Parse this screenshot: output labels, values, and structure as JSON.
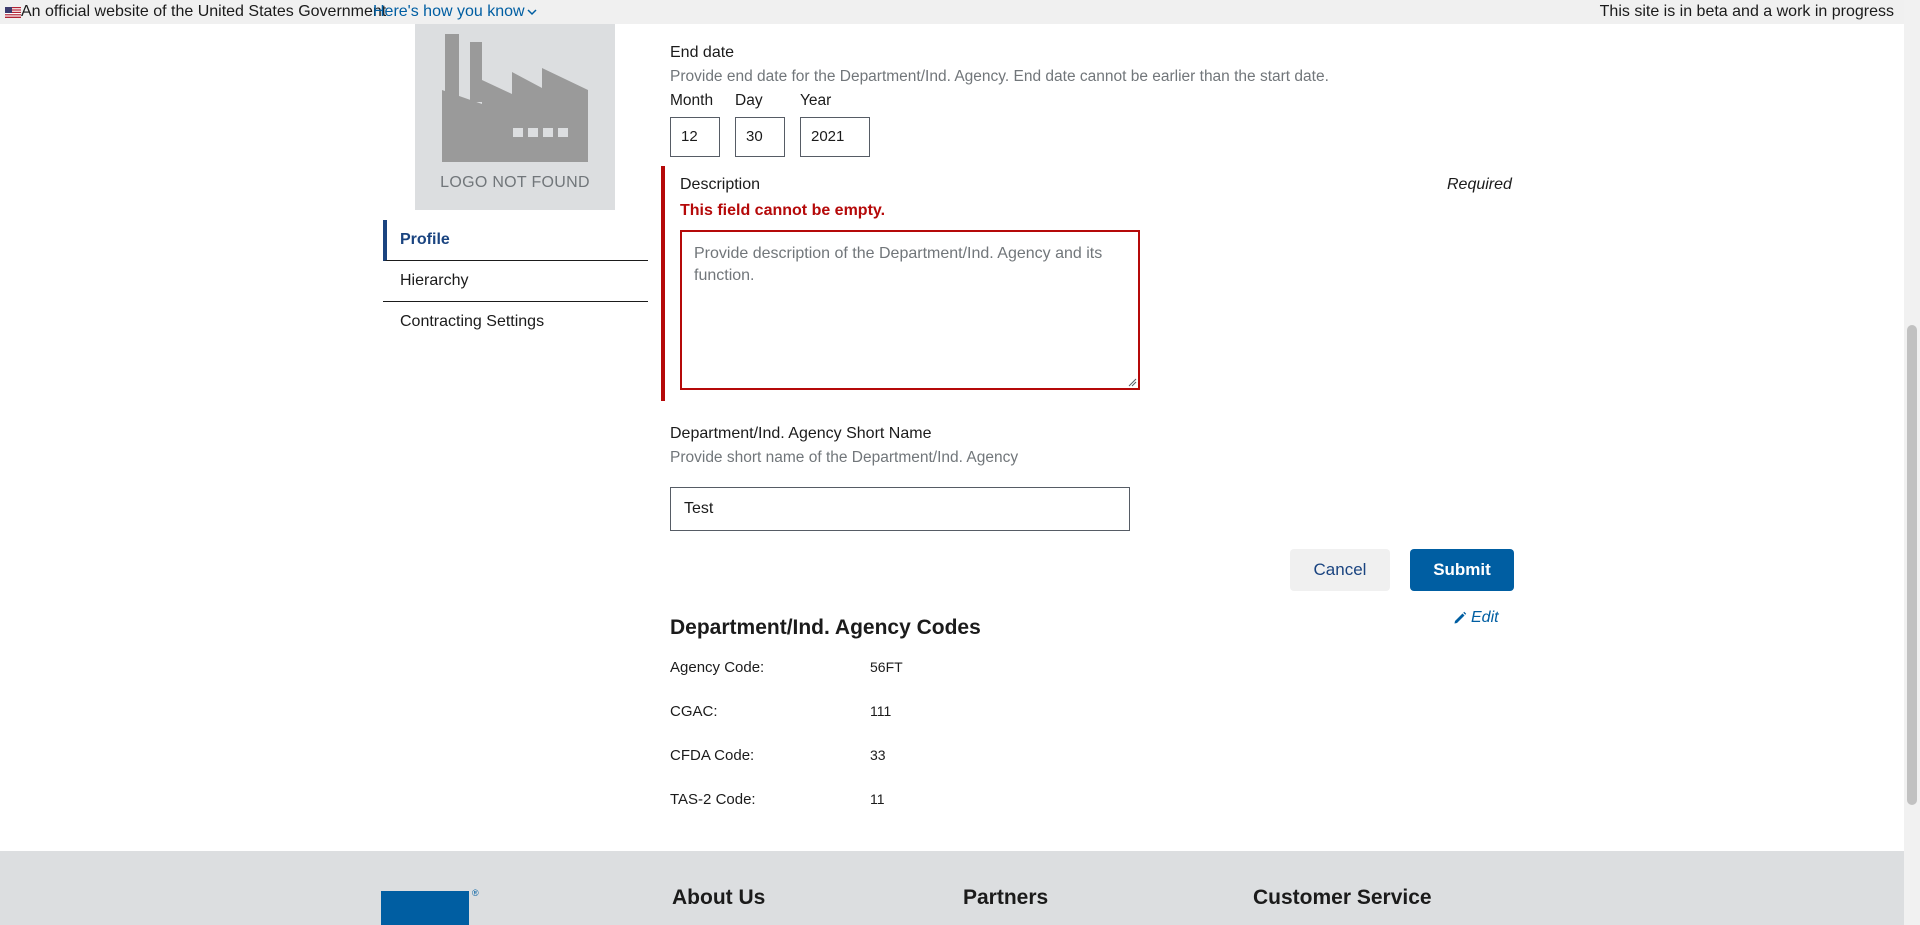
{
  "banner": {
    "official_text": "An official website of the United States Government",
    "how_you_know": "Here's how you know",
    "beta_text": "This site is in beta and a work in progress"
  },
  "logo": {
    "text": "LOGO NOT FOUND"
  },
  "sidenav": {
    "items": [
      {
        "label": "Profile"
      },
      {
        "label": "Hierarchy"
      },
      {
        "label": "Contracting Settings"
      }
    ]
  },
  "end_date": {
    "label": "End date",
    "hint": "Provide end date for the Department/Ind. Agency. End date cannot be earlier than the start date.",
    "month_label": "Month",
    "day_label": "Day",
    "year_label": "Year",
    "month_value": "12",
    "day_value": "30",
    "year_value": "2021"
  },
  "description": {
    "label": "Description",
    "required": "Required",
    "error": "This field cannot be empty.",
    "value": "",
    "placeholder": "Provide description of the Department/Ind. Agency and its function."
  },
  "short_name": {
    "label": "Department/Ind. Agency Short Name",
    "hint": "Provide short name of the Department/Ind. Agency",
    "value": "Test"
  },
  "actions": {
    "cancel": "Cancel",
    "submit": "Submit"
  },
  "codes": {
    "title": "Department/Ind. Agency Codes",
    "edit": "Edit",
    "rows": [
      {
        "label": "Agency Code:",
        "value": "56FT"
      },
      {
        "label": "CGAC:",
        "value": "111"
      },
      {
        "label": "CFDA Code:",
        "value": "33"
      },
      {
        "label": "TAS-2 Code:",
        "value": "11"
      }
    ]
  },
  "footer": {
    "columns": [
      "About Us",
      "Partners",
      "Customer Service"
    ]
  },
  "colors": {
    "primary": "#005ea2",
    "error": "#b50909",
    "nav_active": "#1a4480"
  }
}
